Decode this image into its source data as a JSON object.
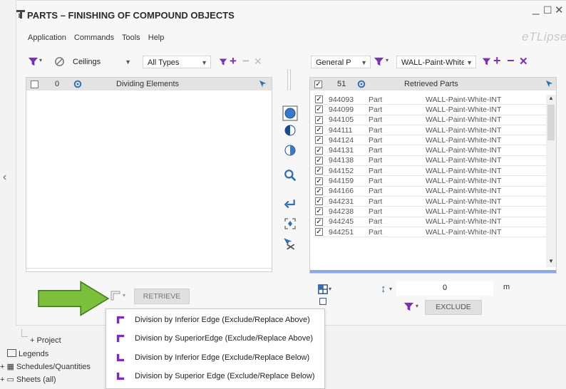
{
  "window": {
    "title": "PARTS – FINISHING OF COMPOUND OBJECTS",
    "minimize": "_",
    "maximize": "☐",
    "close": "✕",
    "logo": "eTLipse"
  },
  "menu": [
    "Application",
    "Commands",
    "Tools",
    "Help"
  ],
  "left": {
    "category": "Ceilings",
    "type": "All Types",
    "count": "0",
    "header": "Dividing Elements"
  },
  "right": {
    "param": "General P",
    "value": "WALL-Paint-White-INT",
    "count": "51",
    "header": "Retrieved Parts",
    "rows": [
      {
        "id": "944093",
        "type": "Part",
        "name": "WALL-Paint-White-INT"
      },
      {
        "id": "944099",
        "type": "Part",
        "name": "WALL-Paint-White-INT"
      },
      {
        "id": "944105",
        "type": "Part",
        "name": "WALL-Paint-White-INT"
      },
      {
        "id": "944111",
        "type": "Part",
        "name": "WALL-Paint-White-INT"
      },
      {
        "id": "944124",
        "type": "Part",
        "name": "WALL-Paint-White-INT"
      },
      {
        "id": "944131",
        "type": "Part",
        "name": "WALL-Paint-White-INT"
      },
      {
        "id": "944138",
        "type": "Part",
        "name": "WALL-Paint-White-INT"
      },
      {
        "id": "944152",
        "type": "Part",
        "name": "WALL-Paint-White-INT"
      },
      {
        "id": "944159",
        "type": "Part",
        "name": "WALL-Paint-White-INT"
      },
      {
        "id": "944166",
        "type": "Part",
        "name": "WALL-Paint-White-INT"
      },
      {
        "id": "944231",
        "type": "Part",
        "name": "WALL-Paint-White-INT"
      },
      {
        "id": "944238",
        "type": "Part",
        "name": "WALL-Paint-White-INT"
      },
      {
        "id": "944245",
        "type": "Part",
        "name": "WALL-Paint-White-INT"
      },
      {
        "id": "944251",
        "type": "Part",
        "name": "WALL-Paint-White-INT"
      }
    ]
  },
  "buttons": {
    "retrieve": "RETRIEVE",
    "exclude": "EXCLUDE"
  },
  "offset": {
    "value": "0",
    "unit": "m"
  },
  "popup": [
    "Division by Inferior Edge (Exclude/Replace Above)",
    "Division by SuperiorEdge (Exclude/Replace Above)",
    "Division by Inferior Edge (Exclude/Replace Below)",
    "Division by Superior Edge (Exclude/Replace Below)"
  ],
  "tree": {
    "project": "Project",
    "legends": "Legends",
    "schedules": "Schedules/Quantities",
    "sheets": "Sheets (all)"
  },
  "colors": {
    "accent": "#2f6fb5",
    "arrow": "#7bbf3a",
    "selection": "#8aa8e6"
  }
}
